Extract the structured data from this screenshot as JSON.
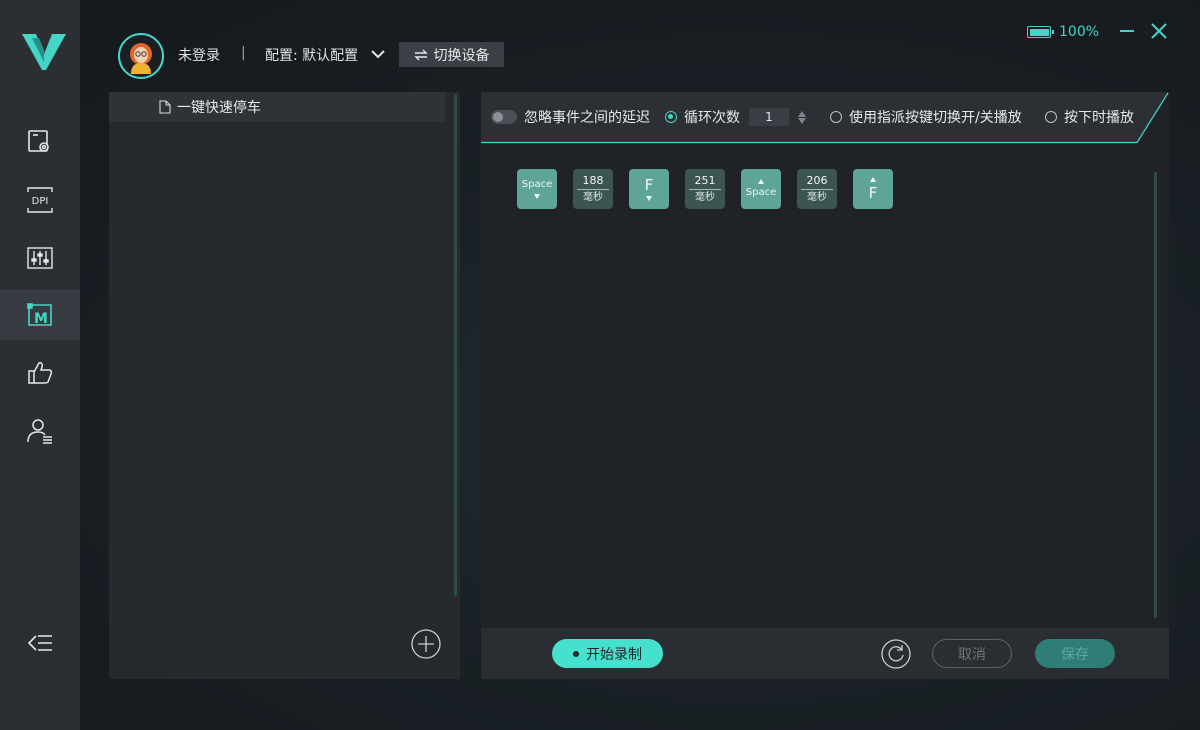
{
  "header": {
    "user_status": "未登录",
    "separator": "|",
    "config_label": "配置: 默认配置",
    "switch_device": "切换设备",
    "battery": "100%"
  },
  "colors": {
    "accent": "#46d4c6",
    "key_event": "#5fa597",
    "delay_event": "#3d5550"
  },
  "sidebar": {
    "items": [
      {
        "icon": "device-settings-icon"
      },
      {
        "icon": "dpi-icon"
      },
      {
        "icon": "equalizer-icon"
      },
      {
        "icon": "macro-icon",
        "active": true
      },
      {
        "icon": "thumbs-up-icon"
      },
      {
        "icon": "user-list-icon"
      }
    ],
    "collapse_icon": "collapse-menu-icon"
  },
  "macro_list": {
    "items": [
      {
        "label": "一键快速停车"
      }
    ]
  },
  "toolbar": {
    "ignore_delay": "忽略事件之间的延迟",
    "loop_count_label": "循环次数",
    "loop_count_value": "1",
    "toggle_by_key": "使用指派按键切换开/关播放",
    "play_while_pressed": "按下时播放"
  },
  "events": [
    {
      "type": "key",
      "label": "Space",
      "dir": "down"
    },
    {
      "type": "delay",
      "value": "188",
      "unit": "毫秒"
    },
    {
      "type": "key",
      "label": "F",
      "dir": "down"
    },
    {
      "type": "delay",
      "value": "251",
      "unit": "毫秒"
    },
    {
      "type": "key",
      "label": "Space",
      "dir": "up"
    },
    {
      "type": "delay",
      "value": "206",
      "unit": "毫秒"
    },
    {
      "type": "key",
      "label": "F",
      "dir": "up"
    }
  ],
  "bottom": {
    "record": "开始录制",
    "cancel": "取消",
    "save": "保存"
  }
}
